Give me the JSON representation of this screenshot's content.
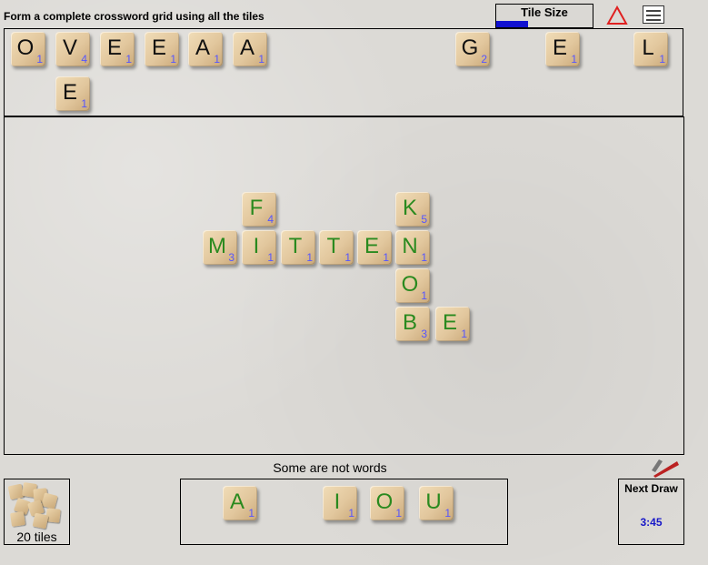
{
  "instruction": "Form a complete crossword grid using all the tiles",
  "tile_size": {
    "label": "Tile Size",
    "level": 0.33
  },
  "icons": {
    "warning": "warning-triangle-icon",
    "rules_card": "rules-card-icon",
    "rules_logo": "the-rules-logo-icon",
    "tile_bag": "tile-bag-icon"
  },
  "colors": {
    "placed_letter": "#2a8a1f",
    "rack_letter": "#111111",
    "points": "#5555ff",
    "timer": "#1818c8",
    "tile_size_bar": "#1010d0",
    "warning": "#e02020"
  },
  "top_rack": [
    {
      "letter": "O",
      "points": "1"
    },
    {
      "letter": "V",
      "points": "4"
    },
    {
      "letter": "E",
      "points": "1"
    },
    {
      "letter": "E",
      "points": "1"
    },
    {
      "letter": "A",
      "points": "1"
    },
    {
      "letter": "A",
      "points": "1"
    },
    {
      "letter": "G",
      "points": "2"
    },
    {
      "letter": "E",
      "points": "1"
    },
    {
      "letter": "L",
      "points": "1"
    },
    {
      "letter": "E",
      "points": "1"
    }
  ],
  "board_tiles": [
    {
      "letter": "F",
      "points": "4"
    },
    {
      "letter": "K",
      "points": "5"
    },
    {
      "letter": "M",
      "points": "3"
    },
    {
      "letter": "I",
      "points": "1"
    },
    {
      "letter": "T",
      "points": "1"
    },
    {
      "letter": "T",
      "points": "1"
    },
    {
      "letter": "E",
      "points": "1"
    },
    {
      "letter": "N",
      "points": "1"
    },
    {
      "letter": "O",
      "points": "1"
    },
    {
      "letter": "B",
      "points": "3"
    },
    {
      "letter": "E",
      "points": "1"
    }
  ],
  "status_message": "Some are not words",
  "bag": {
    "count_label": "20 tiles"
  },
  "bottom_rack": [
    {
      "letter": "A",
      "points": "1"
    },
    {
      "letter": "I",
      "points": "1"
    },
    {
      "letter": "O",
      "points": "1"
    },
    {
      "letter": "U",
      "points": "1"
    }
  ],
  "next_draw": {
    "label": "Next Draw",
    "time": "3:45"
  }
}
